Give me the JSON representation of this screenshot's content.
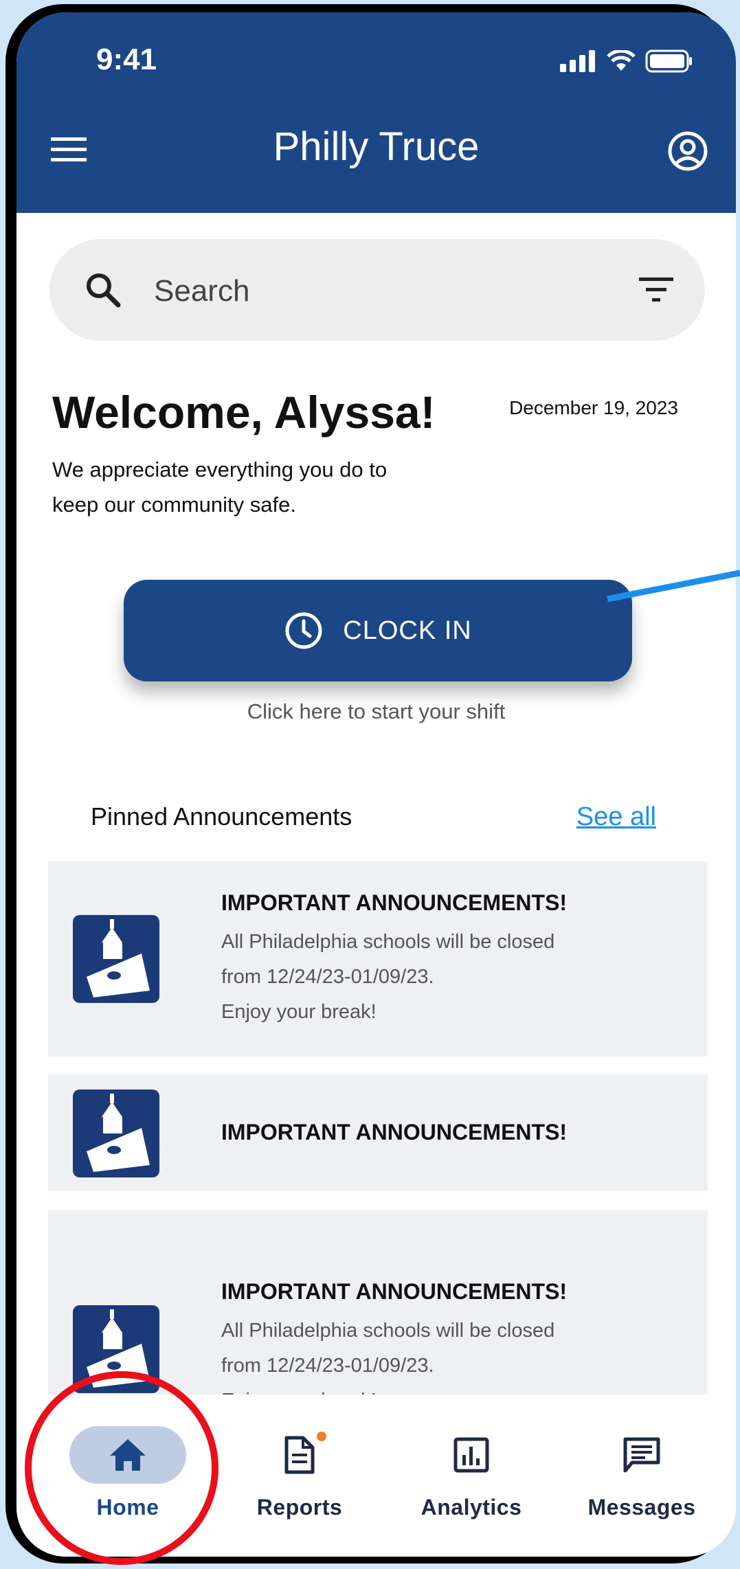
{
  "status_bar": {
    "time": "9:41"
  },
  "header": {
    "title": "Philly Truce"
  },
  "search": {
    "placeholder": "Search"
  },
  "welcome": {
    "greeting": "Welcome, Alyssa!",
    "date": "December 19, 2023",
    "message": "We appreciate everything you do to keep our community safe."
  },
  "clock_in": {
    "label": "CLOCK IN",
    "hint": "Click here to start your shift"
  },
  "pinned": {
    "title": "Pinned Announcements",
    "see_all": "See all",
    "items": [
      {
        "title": "IMPORTANT ANNOUNCEMENTS!",
        "lines": [
          "All Philadelphia schools will be closed",
          "from 12/24/23-01/09/23.",
          "Enjoy your break!"
        ]
      },
      {
        "title": "IMPORTANT ANNOUNCEMENTS!",
        "lines": []
      },
      {
        "title": "IMPORTANT ANNOUNCEMENTS!",
        "lines": [
          "All Philadelphia schools will be closed",
          "from 12/24/23-01/09/23.",
          "Enjoy your break!"
        ]
      }
    ]
  },
  "bottom_nav": {
    "items": [
      {
        "label": "Home",
        "icon": "home-icon",
        "active": true
      },
      {
        "label": "Reports",
        "icon": "document-icon",
        "badge": true
      },
      {
        "label": "Analytics",
        "icon": "chart-icon"
      },
      {
        "label": "Messages",
        "icon": "message-icon"
      }
    ]
  },
  "colors": {
    "brand": "#1c4787",
    "link": "#1b8ff0",
    "highlight_circle": "#e8101a",
    "badge": "#ef7d2a"
  }
}
